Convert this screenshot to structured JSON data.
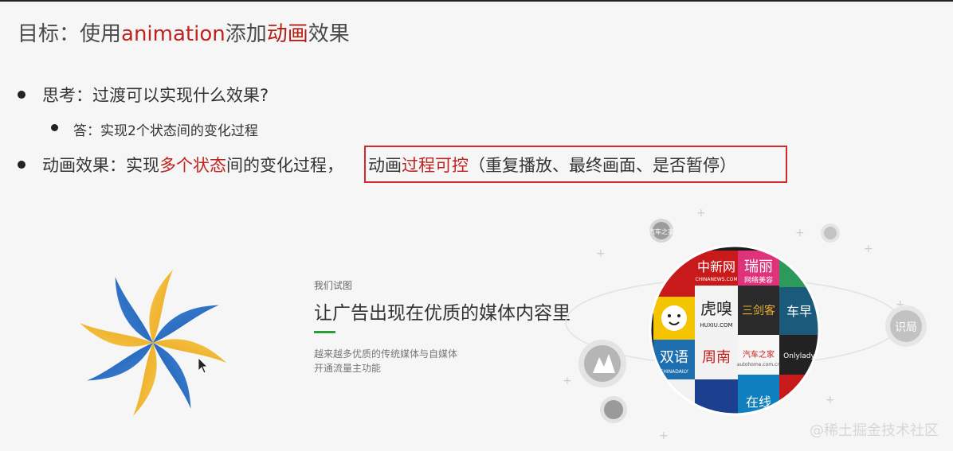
{
  "title": {
    "prefix": "目标：使用",
    "keyword1": "animation",
    "middle": "添加",
    "keyword2": "动画",
    "suffix": "效果"
  },
  "bullets": {
    "b1": "思考：过渡可以实现什么效果?",
    "b2": "答：实现2个状态间的变化过程",
    "b3_prefix": "动画效果：实现",
    "b3_highlight": "多个状态",
    "b3_suffix": "间的变化过程，",
    "box_prefix": "动画",
    "box_highlight": "过程可控",
    "box_suffix": "（重复播放、最终画面、是否暂停）"
  },
  "ad": {
    "small": "我们试图",
    "title": "让广告出现在优质的媒体内容里",
    "desc1": "越来越多优质的传统媒体与自媒体",
    "desc2": "开通流量主功能"
  },
  "media_tiles": [
    "中新网",
    "瑞丽",
    "虎嗅",
    "三剑客",
    "车早",
    "双语",
    "周南",
    "汽车之家",
    "Onlylady",
    "在线"
  ],
  "tile_brand_labels": {
    "zhongxin": "CHINANEWS.COM",
    "ruili": "网络美容",
    "huxiu": "HUXIU.COM",
    "chinadaily": "CHINADAILY",
    "autohome": "autohome.com.cn"
  },
  "orbit_labels": {
    "left_top": "汽车之家",
    "right": "识局",
    "far_right": ""
  },
  "watermark": "@稀土掘金技术社区",
  "colors": {
    "accent_red": "#c0221c",
    "box_border": "#d3282a",
    "green_line": "#2a9d3a"
  }
}
